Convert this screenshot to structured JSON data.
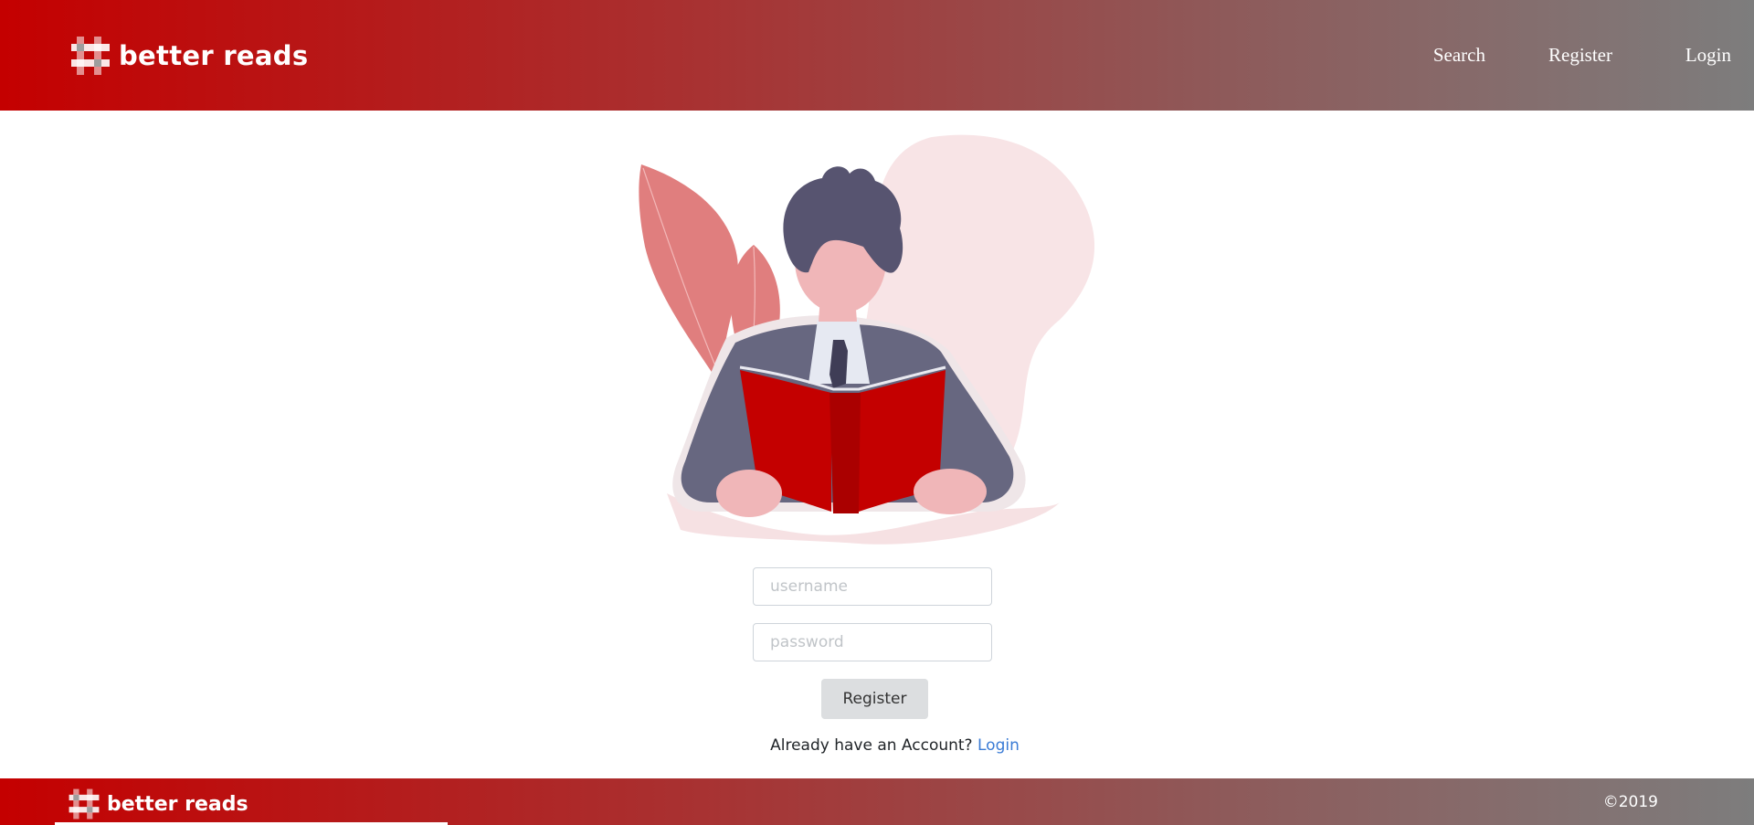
{
  "header": {
    "brand": "better reads",
    "nav": [
      {
        "label": "Search"
      },
      {
        "label": "Register"
      },
      {
        "label": "Login"
      }
    ]
  },
  "form": {
    "username_placeholder": "username",
    "password_placeholder": "password",
    "submit_label": "Register",
    "account_prompt": "Already have an Account?",
    "login_link": "Login"
  },
  "footer": {
    "brand": "better reads",
    "copyright": "©2019"
  },
  "colors": {
    "header_gradient_start": "#c40000",
    "header_gradient_end": "#7d7d7d",
    "book": "#c40000",
    "leaf": "#e07e7e",
    "blob": "#f8e4e6",
    "suit": "#676780",
    "hair": "#575470",
    "link": "#3a7bd5"
  },
  "icons": {
    "logo": "hash-grid-icon"
  }
}
